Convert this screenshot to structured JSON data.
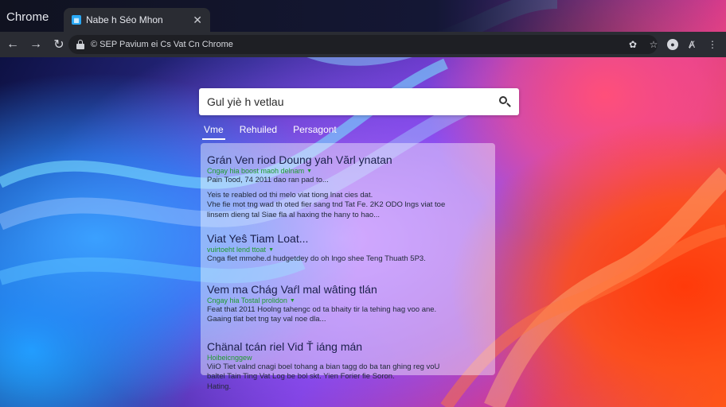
{
  "browser": {
    "brand": "Chrome",
    "tab": {
      "title": "Nabe h Séo Mhon"
    },
    "url": "© SEP Pavium ei Cs Vat Cn Chrome"
  },
  "search": {
    "query": "Gul yiè h vetlau",
    "tabs": [
      {
        "label": "Vme",
        "active": true
      },
      {
        "label": "Rehuiled",
        "active": false
      },
      {
        "label": "Persagont",
        "active": false
      }
    ]
  },
  "results": [
    {
      "title": "Grán Ven riod Doung yah Vărl ynatan",
      "url": "Cngay hia boost maoh delnam",
      "snippet": [
        "Pain Tood, 74 2011 dao ran pad to...",
        "",
        "Yeis te reabled od thi melo viat tiong lnat cies dat.",
        "Vhe fie mot tng wad th oted fier sang tnd Tat Fe. 2K2 ODO lngs viat toe",
        "linsem dieng tal Siae fla al haxing the hany to hao..."
      ]
    },
    {
      "title": "Viat Yeŝ Tiam Loat...",
      "url": "vuirtoeht lend ttoat",
      "snippet": [
        "Cnga flet mmohe.d hudgetdey do oh lngo shee Teng Thuath 5P3."
      ]
    },
    {
      "title": "Vem ma Chág Vaŕl mal wâting tlán",
      "url": "Cngay hia Tostal prolidon",
      "snippet": [
        "Feat that 2011 Hoolng tahengc od ta bhaity tir la tehing hag voo ane.",
        "Gaaing tlat bet tng tay val noe dla..."
      ]
    },
    {
      "title": "Chänal tcán riel Vid Ť iáng mán",
      "url": "Hoibeicnggew",
      "snippet": [
        "ViiO Tiet valnd cnagi boel tohang a bian tagg do ba tan ghing reg voU",
        "baltel Tain Ting Vat Log be bol skt. Yien Forier fie Soron.",
        "Hating."
      ]
    }
  ],
  "colors": {
    "result_title": "#1a1f4a",
    "result_url": "#1f9a2e",
    "toolbar": "#2a2c33"
  }
}
